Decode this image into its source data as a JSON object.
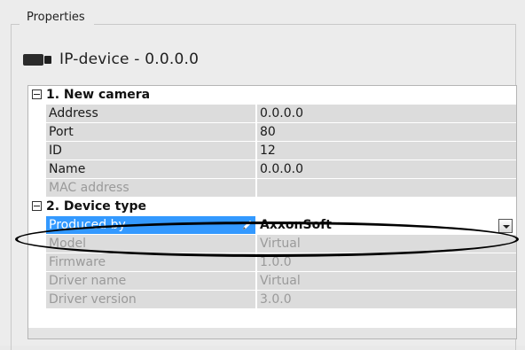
{
  "panel": {
    "title": "Properties"
  },
  "device": {
    "title": "IP-device - 0.0.0.0",
    "icon": "camera-icon"
  },
  "sections": [
    {
      "label": "1. New camera",
      "rows": [
        {
          "name": "Address",
          "value": "0.0.0.0",
          "enabled": true
        },
        {
          "name": "Port",
          "value": "80",
          "enabled": true
        },
        {
          "name": "ID",
          "value": "12",
          "enabled": true
        },
        {
          "name": "Name",
          "value": "0.0.0.0",
          "enabled": true
        },
        {
          "name": "MAC address",
          "value": "",
          "enabled": false
        }
      ]
    },
    {
      "label": "2. Device type",
      "rows": [
        {
          "name": "Produced by",
          "value": "AxxonSoft",
          "selected": true
        },
        {
          "name": "Model",
          "value": "Virtual",
          "enabled": false
        },
        {
          "name": "Firmware",
          "value": "1.0.0",
          "enabled": false
        },
        {
          "name": "Driver name",
          "value": "Virtual",
          "enabled": false
        },
        {
          "name": "Driver version",
          "value": "3.0.0",
          "enabled": false
        }
      ]
    }
  ],
  "colors": {
    "selection": "#3399ff",
    "cell": "#dcdcdc",
    "disabled_text": "#9a9a9a"
  }
}
